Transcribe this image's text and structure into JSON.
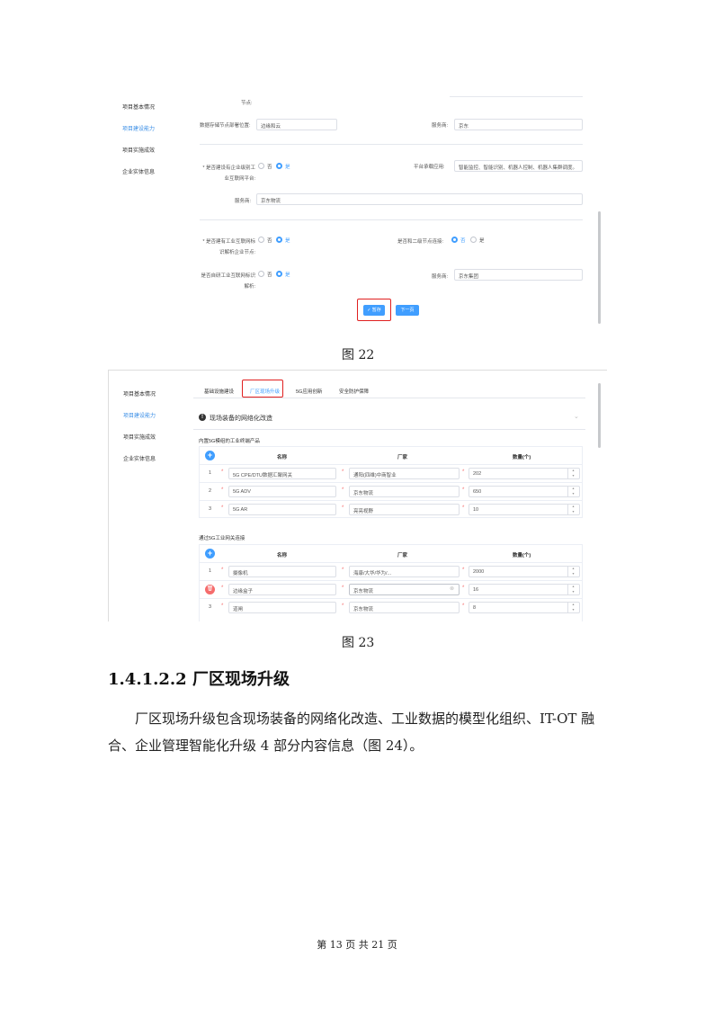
{
  "fig22": {
    "sidebar": [
      "项目基本情况",
      "项目建设能力",
      "项目实施成效",
      "企业实体信息"
    ],
    "top_label": "节点:",
    "storage_label": "数据存储节点部署位置:",
    "storage_value": "边缘和云",
    "service_label_1": "服务商:",
    "service_value_1": "京东",
    "platform_q": "* 是否建设有企业级别工业互联网平台:",
    "radio_no": "否",
    "radio_yes": "是",
    "platform_app_label": "平台承载应用:",
    "platform_app_value": "智能监控、智能识别、机器人控制、机器人集群调度。",
    "service_label_2": "服务商:",
    "service_value_2": "京东物流",
    "identity_q": "* 是否建有工业互联网标识解析企业节点:",
    "secondary_q": "是否和二级节点连接:",
    "research_q": "是否自研工业互联网标识解析:",
    "service_label_3": "服务商:",
    "service_value_3": "京东集团",
    "save_btn": "✓ 暂存",
    "next_btn": "下一页",
    "caption": "图 22"
  },
  "fig23": {
    "sidebar": [
      "项目基本情况",
      "项目建设能力",
      "项目实施成效",
      "企业实体信息"
    ],
    "tabs": [
      "基础设施建设",
      "厂区现场升级",
      "5G应用创新",
      "安全防护保障"
    ],
    "section_title": "现场装备的网络化改造",
    "table1_title": "内置5G模组的工业终端产品",
    "table2_title": "通过5G工业网关连接",
    "col_name": "名称",
    "col_vendor": "厂家",
    "col_qty": "数量(个)",
    "table1_rows": [
      {
        "idx": "1",
        "name": "5G CPE/DTU数据汇聚网关",
        "vendor": "通阳(四维)中商智业",
        "qty": "202"
      },
      {
        "idx": "2",
        "name": "5G ADV",
        "vendor": "京东物流",
        "qty": "650"
      },
      {
        "idx": "3",
        "name": "5G AR",
        "vendor": "亮亮视野",
        "qty": "10"
      }
    ],
    "table2_rows": [
      {
        "idx": "1",
        "name": "摄像机",
        "vendor": "海康/大华/华为/...",
        "qty": "2000"
      },
      {
        "idx": "",
        "name": "边缘盒子",
        "vendor": "京东物流",
        "qty": "16"
      },
      {
        "idx": "3",
        "name": "道闸",
        "vendor": "京东物流",
        "qty": "8"
      }
    ],
    "caption": "图 23"
  },
  "section_heading": "1.4.1.2.2 厂区现场升级",
  "paragraph": "厂区现场升级包含现场装备的网络化改造、工业数据的模型化组织、IT-OT 融合、企业管理智能化升级 4 部分内容信息（图 24）。",
  "footer": "第 13 页 共 21 页",
  "colors": {
    "accent": "#409eff",
    "highlight": "#e02020",
    "danger": "#f56c6c"
  }
}
